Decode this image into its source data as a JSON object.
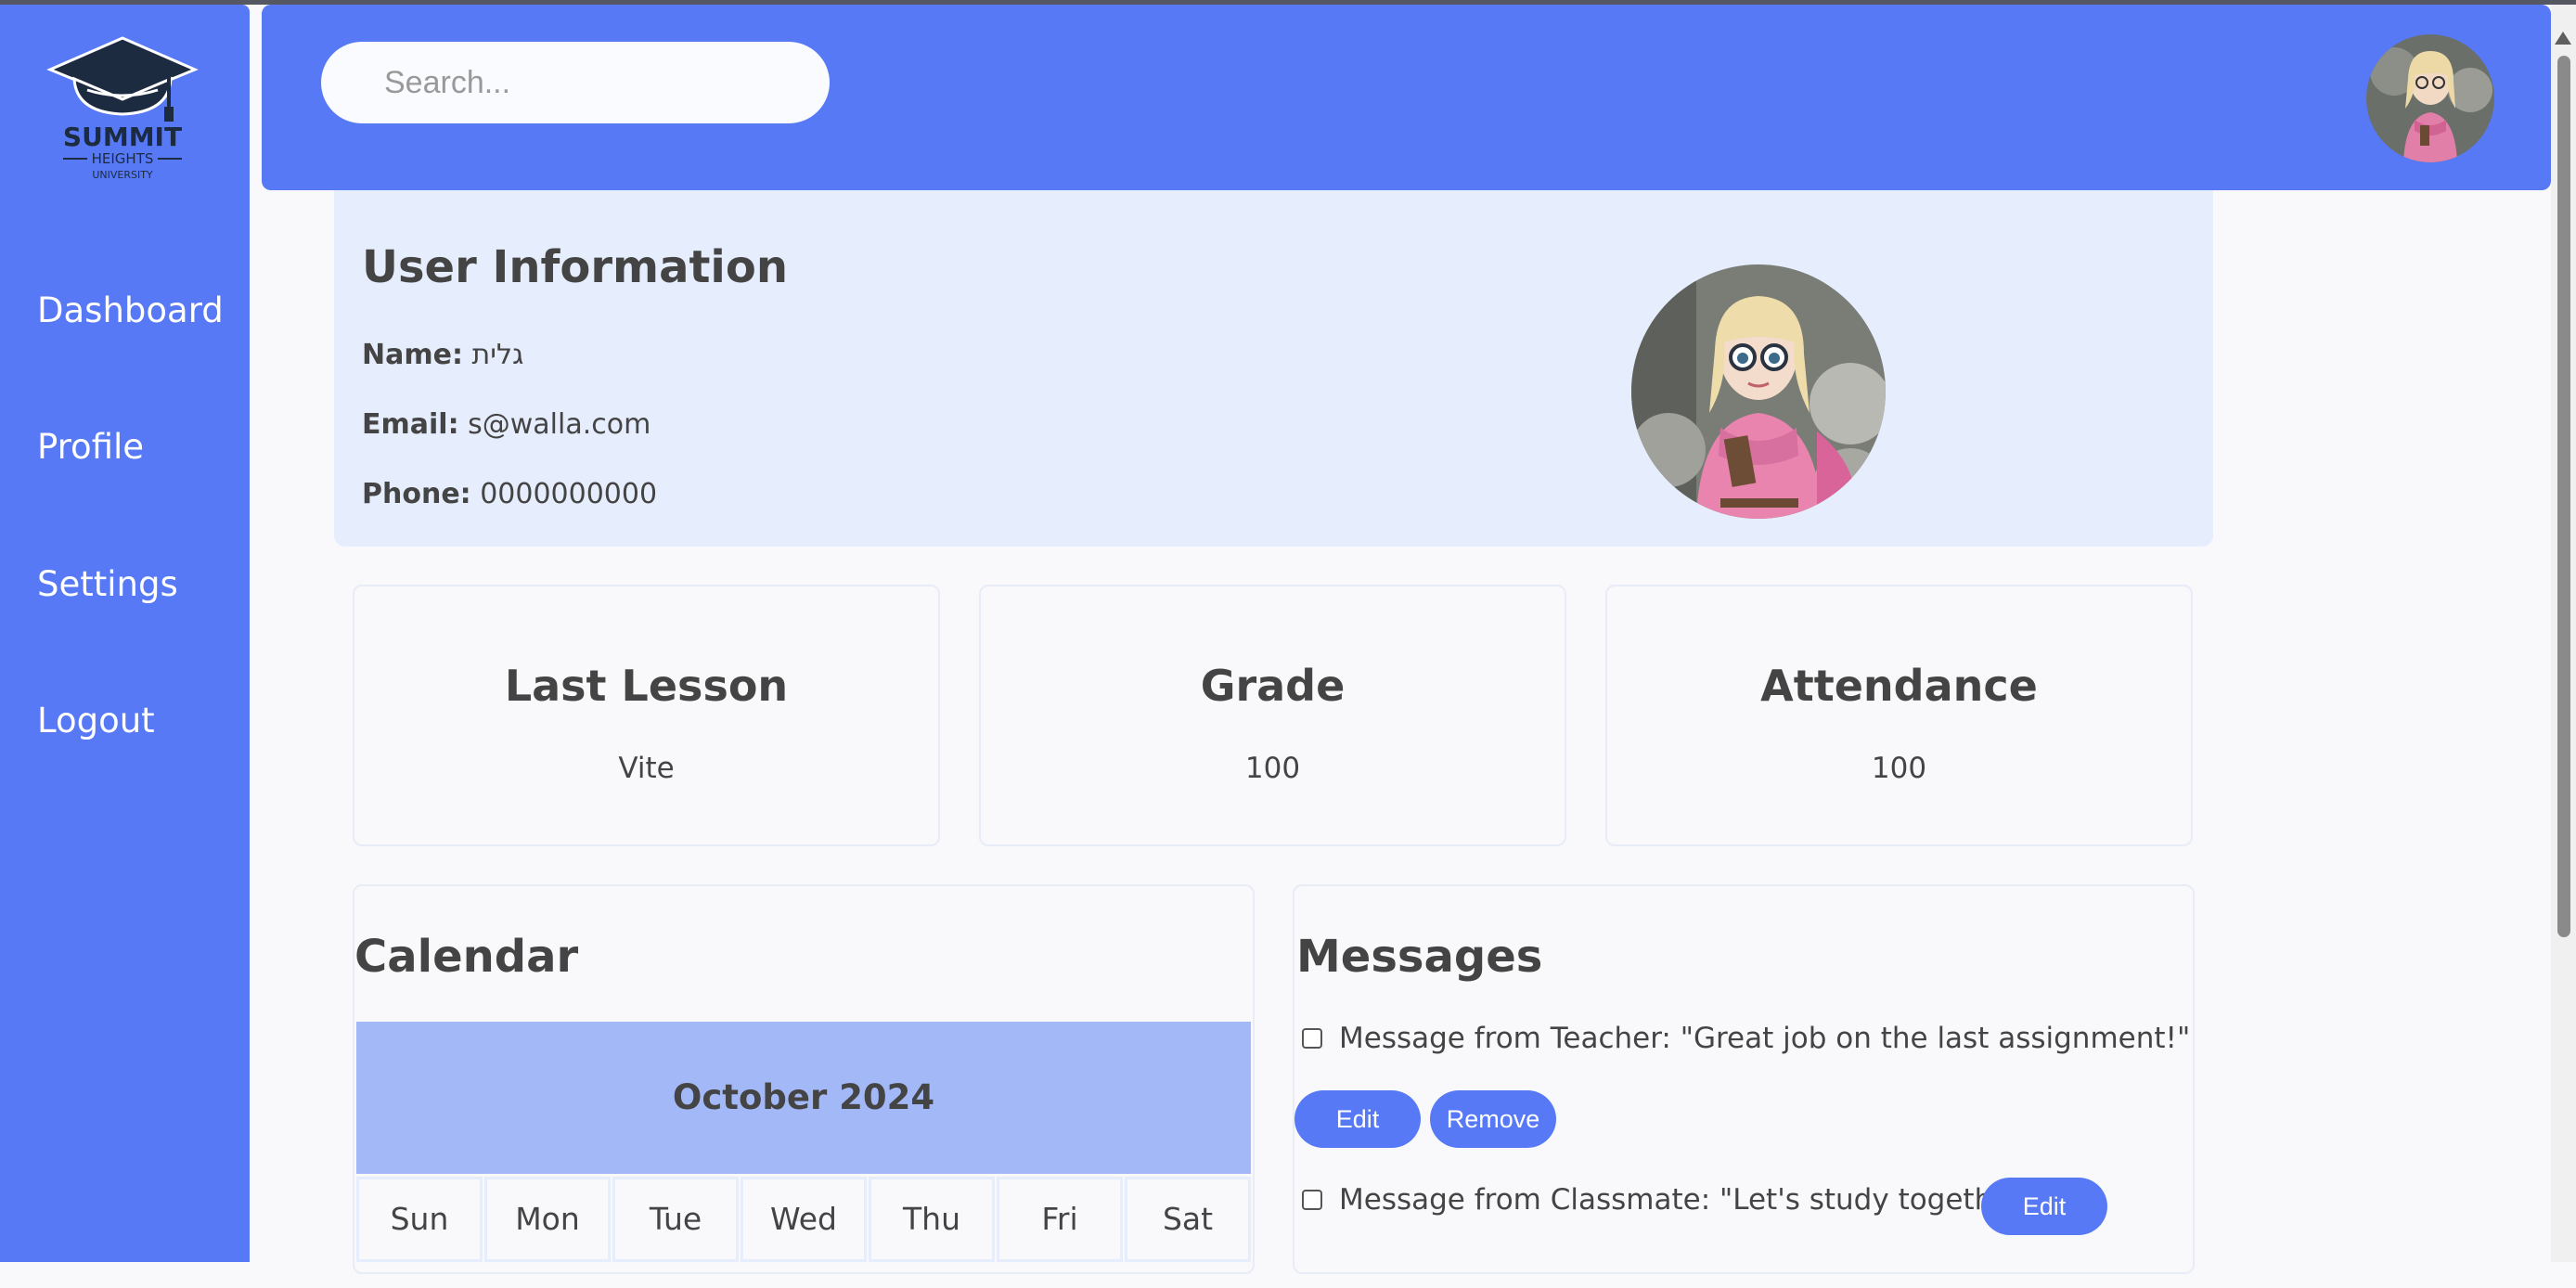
{
  "app": {
    "logo": {
      "line1": "SUMMIT",
      "line2": "HEIGHTS",
      "line3": "UNIVERSITY"
    }
  },
  "sidebar": {
    "items": [
      {
        "label": "Dashboard"
      },
      {
        "label": "Profile"
      },
      {
        "label": "Settings"
      },
      {
        "label": "Logout"
      }
    ]
  },
  "header": {
    "search_placeholder": "Search..."
  },
  "user_info": {
    "title": "User Information",
    "name_label": "Name:",
    "name_value": "גלית",
    "email_label": "Email:",
    "email_value": "s@walla.com",
    "phone_label": "Phone:",
    "phone_value": "0000000000"
  },
  "stats": [
    {
      "title": "Last Lesson",
      "value": "Vite"
    },
    {
      "title": "Grade",
      "value": "100"
    },
    {
      "title": "Attendance",
      "value": "100"
    }
  ],
  "calendar": {
    "title": "Calendar",
    "month": "October 2024",
    "weekdays": [
      "Sun",
      "Mon",
      "Tue",
      "Wed",
      "Thu",
      "Fri",
      "Sat"
    ]
  },
  "messages": {
    "title": "Messages",
    "items": [
      {
        "text": "Message from Teacher: \"Great job on the last assignment!\"",
        "checked": false
      },
      {
        "text": "Message from Classmate: \"Let's study together!\"",
        "checked": false
      }
    ],
    "edit_label": "Edit",
    "remove_label": "Remove"
  },
  "colors": {
    "primary": "#5779f5",
    "panel_bg": "#e6edfc",
    "calendar_header": "#a3b8f7"
  }
}
